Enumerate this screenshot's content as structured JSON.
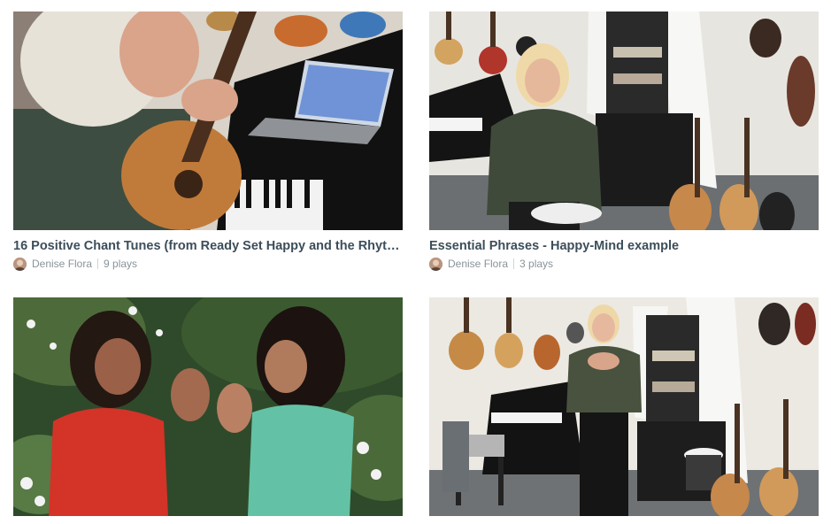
{
  "videos": [
    {
      "title": "16 Positive Chant Tunes (from Ready Set Happy and the Rhythm...",
      "author": "Denise Flora",
      "plays": "9 plays"
    },
    {
      "title": "Essential Phrases - Happy-Mind example",
      "author": "Denise Flora",
      "plays": "3 plays"
    },
    {
      "title": "",
      "author": "",
      "plays": ""
    },
    {
      "title": "",
      "author": "",
      "plays": ""
    }
  ],
  "colors": {
    "title": "#3c4e5a",
    "meta": "#8a9499"
  }
}
